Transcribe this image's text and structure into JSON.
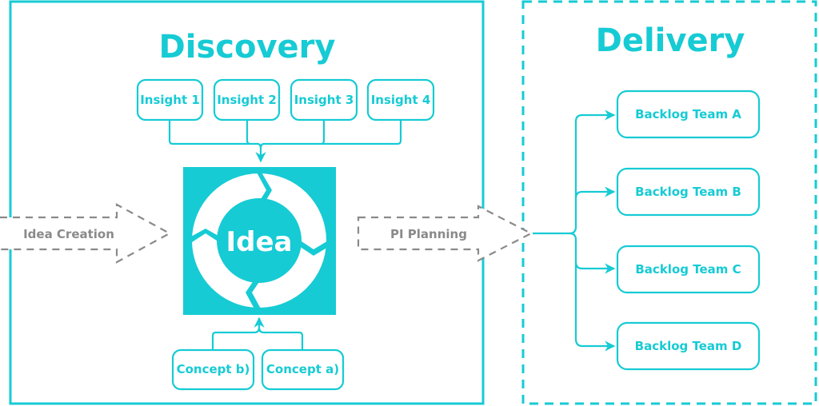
{
  "colors": {
    "accent": "#16cbd4",
    "gray": "#8a8a8a",
    "background": "#ffffff"
  },
  "discovery": {
    "title": "Discovery",
    "insights": [
      "Insight 1",
      "Insight 2",
      "Insight 3",
      "Insight 4"
    ],
    "center": "Idea",
    "concepts": [
      "Concept b)",
      "Concept a)"
    ]
  },
  "flows": {
    "idea_creation": "Idea Creation",
    "pi_planning": "PI Planning"
  },
  "delivery": {
    "title": "Delivery",
    "backlogs": [
      "Backlog Team A",
      "Backlog Team B",
      "Backlog Team C",
      "Backlog Team D"
    ]
  }
}
